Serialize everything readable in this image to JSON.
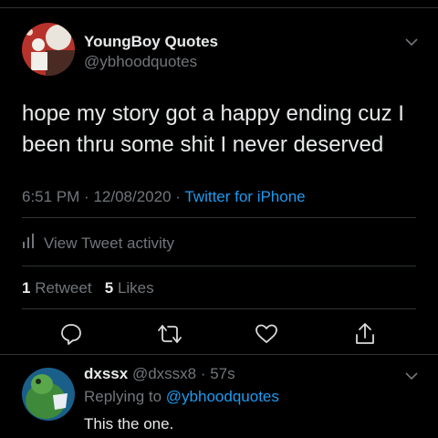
{
  "tweet": {
    "author_name": "YoungBoy Quotes",
    "author_handle": "@ybhoodquotes",
    "text": "hope my story got a happy ending  cuz I been thru some shit I never deserved",
    "time": "6:51 PM",
    "date": "12/08/2020",
    "source": "Twitter for iPhone",
    "activity_label": "View Tweet activity",
    "retweet_count": "1",
    "retweet_label": "Retweet",
    "like_count": "5",
    "like_label": "Likes"
  },
  "reply": {
    "author_name": "dxssx",
    "author_handle": "@dxssx8",
    "age": "57s",
    "replying_prefix": "Replying to",
    "replying_to": "@ybhoodquotes",
    "text": "This the one."
  },
  "icons": {
    "reply": "comment-icon",
    "retweet": "retweet-icon",
    "like": "heart-icon",
    "share": "share-icon",
    "chevron": "chevron-down-icon",
    "activity": "bar-chart-icon"
  },
  "colors": {
    "background": "#000000",
    "link": "#1d9bf0",
    "secondary": "#71767b",
    "primary_text": "#e7e9ea",
    "divider": "#2f3336"
  }
}
